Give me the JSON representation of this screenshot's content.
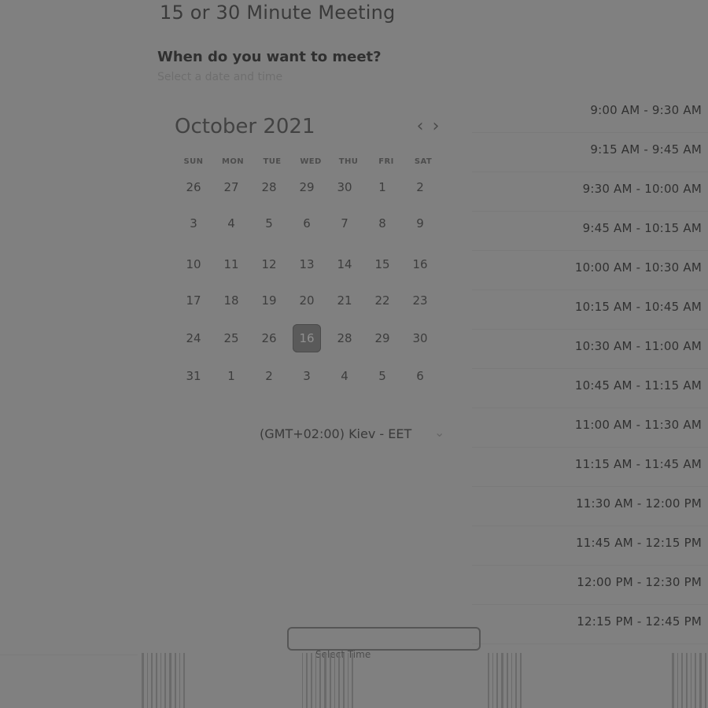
{
  "title": "15 or 30 Minute Meeting",
  "subtitle": "When do you want to meet?",
  "helper": "Select a date and time",
  "calendar": {
    "month_year": "October 2021",
    "prev_symbol": "‹",
    "next_symbol": "›",
    "weekdays": [
      "SUN",
      "MON",
      "TUE",
      "WED",
      "THU",
      "FRI",
      "SAT"
    ],
    "weeks": [
      [
        "26",
        "27",
        "28",
        "29",
        "30",
        "1",
        "2"
      ],
      [
        "3",
        "4",
        "5",
        "6",
        "7",
        "8",
        "9"
      ],
      [
        "10",
        "11",
        "12",
        "13",
        "14",
        "15",
        "16"
      ],
      [
        "17",
        "18",
        "19",
        "20",
        "21",
        "22",
        "23"
      ],
      [
        "24",
        "25",
        "26",
        "16",
        "28",
        "29",
        "30"
      ],
      [
        "31",
        "1",
        "2",
        "3",
        "4",
        "5",
        "6"
      ]
    ],
    "selected_day": "16"
  },
  "timezone": {
    "label": "(GMT+02:00) Kiev - EET",
    "chevron": "⌄"
  },
  "slots": [
    "9:00 AM - 9:30 AM",
    "9:15 AM - 9:45 AM",
    "9:30 AM - 10:00 AM",
    "9:45 AM - 10:15 AM",
    "10:00 AM - 10:30 AM",
    "10:15 AM - 10:45 AM",
    "10:30 AM - 11:00 AM",
    "10:45 AM - 11:15 AM",
    "11:00 AM - 11:30 AM",
    "11:15 AM - 11:45 AM",
    "11:30 AM - 12:00 PM",
    "11:45 AM - 12:15 PM",
    "12:00 PM - 12:30 PM",
    "12:15 PM - 12:45 PM"
  ],
  "footer": {
    "button_label": "Select Time"
  }
}
